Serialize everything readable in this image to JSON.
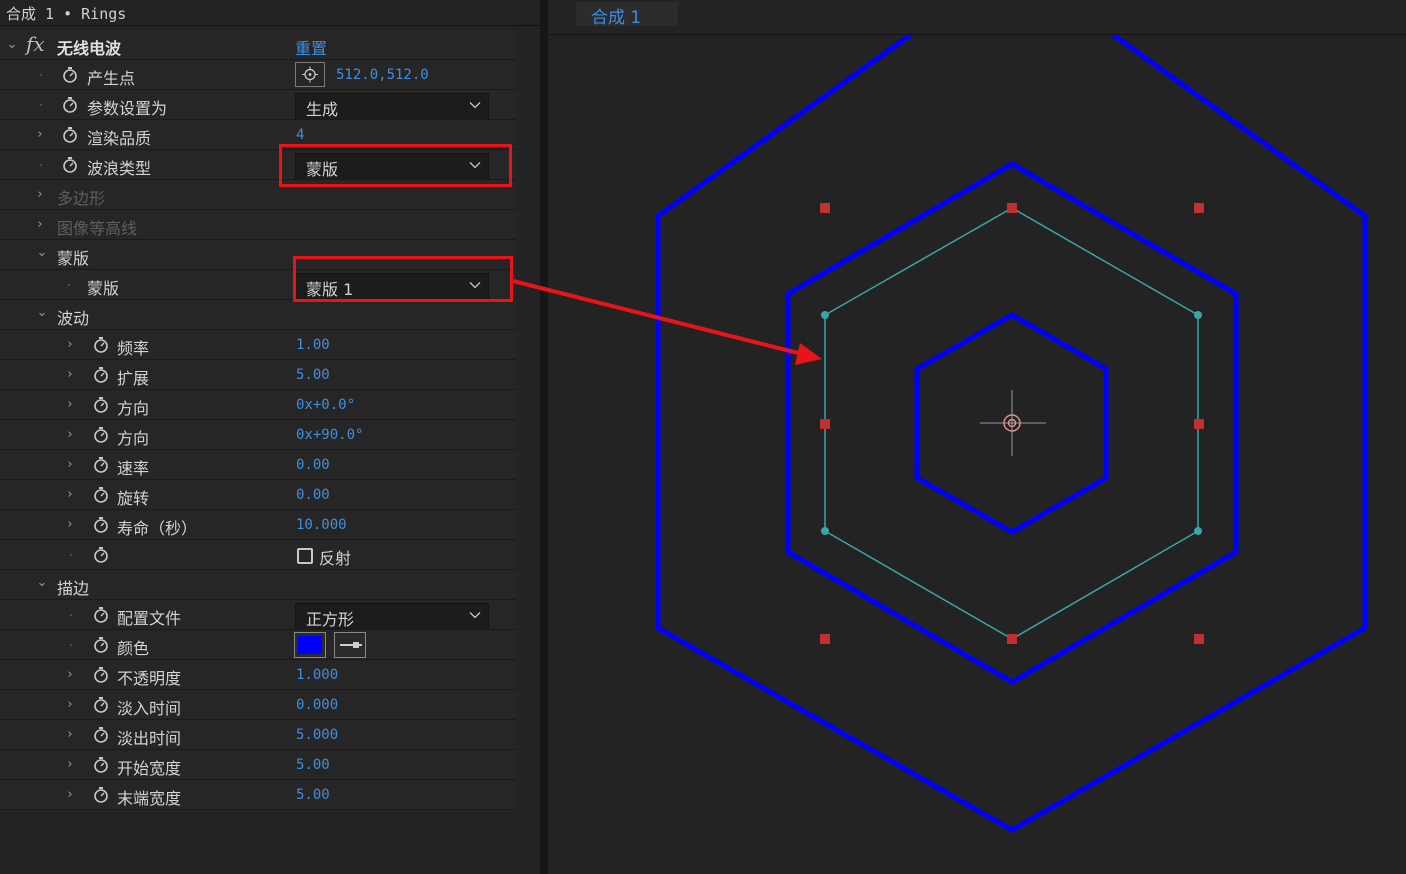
{
  "panel": {
    "title": "合成 1 • Rings",
    "effect": {
      "name": "无线电波",
      "reset": "重置"
    },
    "rows": [
      {
        "label": "产生点",
        "value": "512.0,512.0"
      },
      {
        "label": "参数设置为",
        "value": "生成"
      },
      {
        "label": "渲染品质",
        "value": "4"
      },
      {
        "label": "波浪类型",
        "value": "蒙版"
      },
      {
        "label": "多边形"
      },
      {
        "label": "图像等高线"
      },
      {
        "label": "蒙版"
      },
      {
        "label": "蒙版",
        "value": "蒙版 1"
      },
      {
        "label": "波动"
      },
      {
        "label": "频率",
        "value": "1.00"
      },
      {
        "label": "扩展",
        "value": "5.00"
      },
      {
        "label": "方向",
        "value": "0x+0.0°"
      },
      {
        "label": "方向",
        "value": "0x+90.0°"
      },
      {
        "label": "速率",
        "value": "0.00"
      },
      {
        "label": "旋转",
        "value": "0.00"
      },
      {
        "label": "寿命（秒）",
        "value": "10.000"
      },
      {
        "label": "",
        "value": "反射",
        "checked": false
      },
      {
        "label": "描边"
      },
      {
        "label": "配置文件",
        "value": "正方形"
      },
      {
        "label": "颜色",
        "color": "#0000ff"
      },
      {
        "label": "不透明度",
        "value": "1.000"
      },
      {
        "label": "淡入时间",
        "value": "0.000"
      },
      {
        "label": "淡出时间",
        "value": "5.000"
      },
      {
        "label": "开始宽度",
        "value": "5.00"
      },
      {
        "label": "末端宽度",
        "value": "5.00"
      }
    ]
  },
  "viewer": {
    "tab": "合成 1"
  },
  "colors": {
    "accent": "#3f8fe0",
    "highlight": "#e8141c",
    "ring": "#0000ff",
    "mask_path": "#3aa6a6",
    "handle": "#c03030"
  }
}
